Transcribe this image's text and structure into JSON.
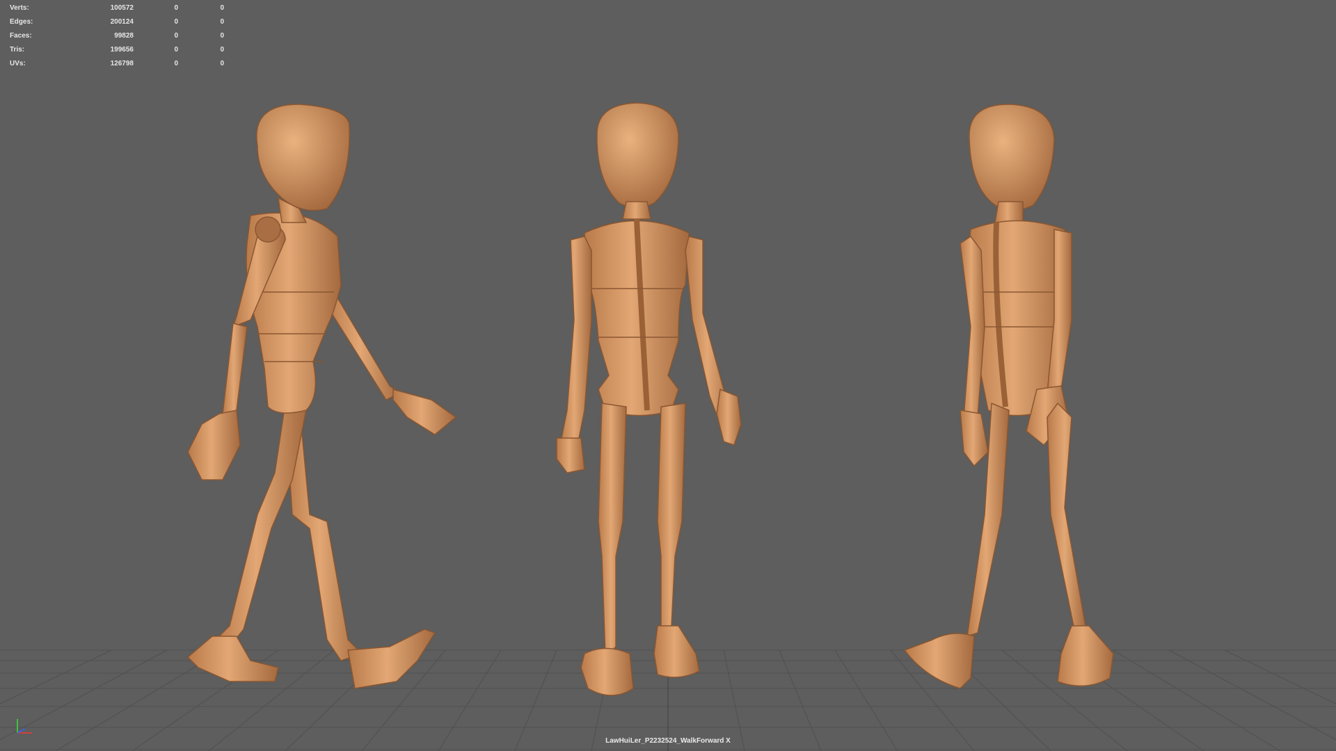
{
  "hud": {
    "rows": [
      {
        "label": "Verts:",
        "values": [
          "100572",
          "0",
          "0"
        ]
      },
      {
        "label": "Edges:",
        "values": [
          "200124",
          "0",
          "0"
        ]
      },
      {
        "label": "Faces:",
        "values": [
          "99828",
          "0",
          "0"
        ]
      },
      {
        "label": "Tris:",
        "values": [
          "199656",
          "0",
          "0"
        ]
      },
      {
        "label": "UVs:",
        "values": [
          "126798",
          "0",
          "0"
        ]
      }
    ]
  },
  "scene": {
    "caption": "LawHuiLer_P2232524_WalkForward X",
    "figure_names": [
      "side-view",
      "front-view",
      "three-quarter-view"
    ]
  },
  "axis_gizmo": {
    "icon": "axis-gizmo-icon"
  },
  "colors": {
    "viewport_bg": "#5d5e5d",
    "grid_line": "#4d4e4d",
    "mannequin_skin": "#d79d6b",
    "mannequin_shade": "#a96e43",
    "hud_text": "#e6e6e6"
  }
}
